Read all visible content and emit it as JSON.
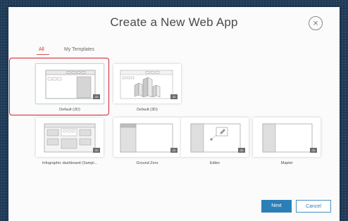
{
  "dialog": {
    "title": "Create a New Web App",
    "close_symbol": "×"
  },
  "tabs": [
    {
      "label": "All",
      "active": true
    },
    {
      "label": "My Templates",
      "active": false
    }
  ],
  "templates": [
    {
      "label": "Default (2D)",
      "badge": "2D",
      "selected": true,
      "icon": "default-2d-thumbnail"
    },
    {
      "label": "Default (3D)",
      "badge": "3D",
      "selected": false,
      "icon": "default-3d-city-thumbnail"
    },
    {
      "label": "Infographic dashboard (Sampl...",
      "badge": "2D",
      "selected": false,
      "icon": "infographic-dashboard-thumbnail"
    },
    {
      "label": "Ground Zero",
      "badge": "2D",
      "selected": false,
      "icon": "ground-zero-thumbnail"
    },
    {
      "label": "Editor",
      "badge": "2D",
      "selected": false,
      "icon": "editor-thumbnail"
    },
    {
      "label": "Maplet",
      "badge": "2D",
      "selected": false,
      "icon": "maplet-thumbnail"
    }
  ],
  "buttons": {
    "next_label": "Next",
    "cancel_label": "Cancel"
  },
  "colors": {
    "accent": "#2a7fb6",
    "selection_outline": "#d11e2d",
    "active_tab": "#c0392b"
  }
}
